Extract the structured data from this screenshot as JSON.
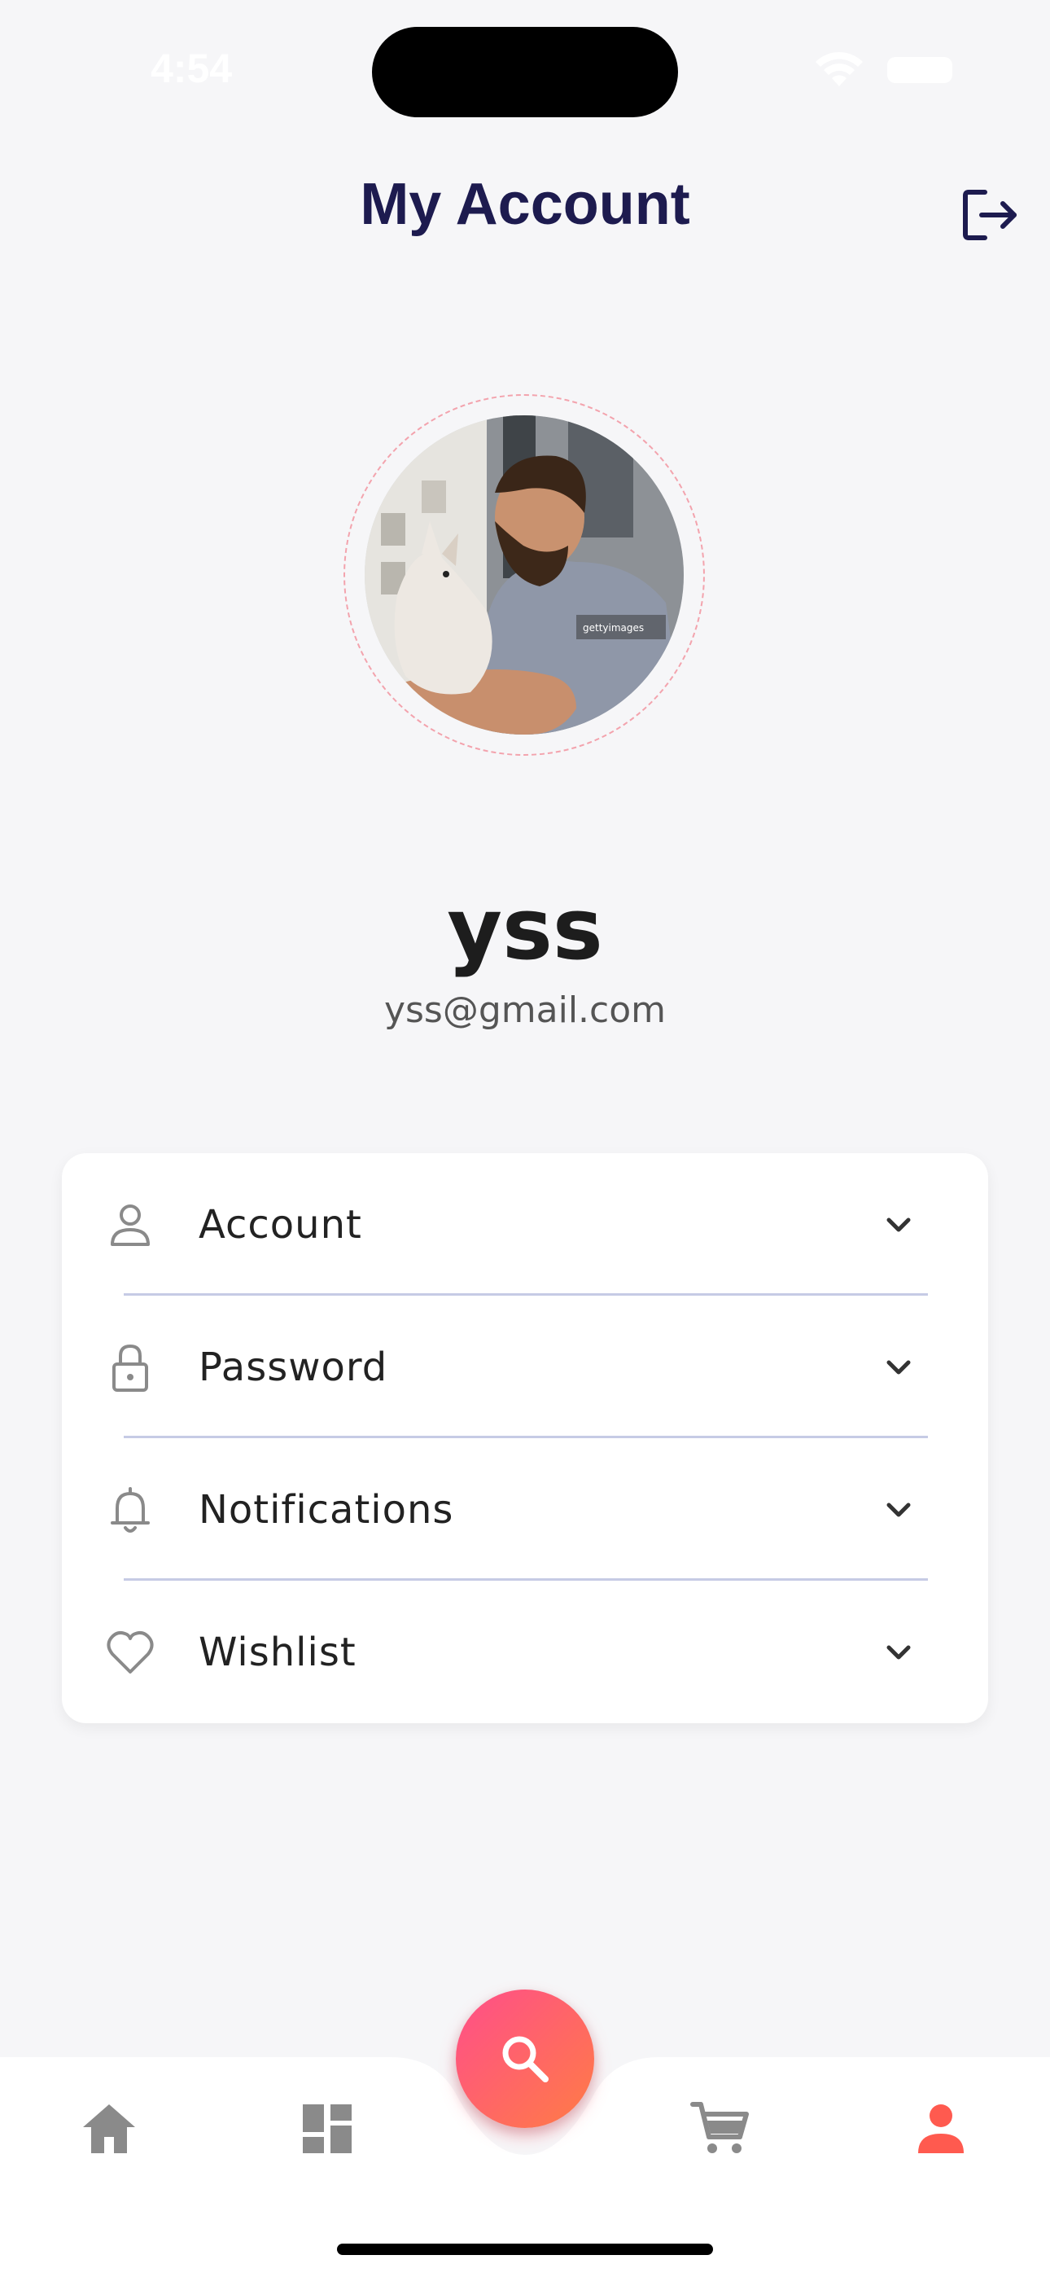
{
  "status_bar": {
    "time": "4:54"
  },
  "header": {
    "title": "My Account",
    "logout_icon": "logout-icon"
  },
  "profile": {
    "name": "yss",
    "email": "yss@gmail.com",
    "avatar_alt": "profile photo"
  },
  "menu": {
    "items": [
      {
        "label": "Account",
        "icon": "person-icon"
      },
      {
        "label": "Password",
        "icon": "lock-icon"
      },
      {
        "label": "Notifications",
        "icon": "bell-icon"
      },
      {
        "label": "Wishlist",
        "icon": "heart-icon"
      }
    ]
  },
  "bottom_nav": {
    "items": [
      {
        "name": "home",
        "icon": "home-icon"
      },
      {
        "name": "categories",
        "icon": "dashboard-icon"
      },
      {
        "name": "search",
        "icon": "search-icon"
      },
      {
        "name": "cart",
        "icon": "cart-icon"
      },
      {
        "name": "profile",
        "icon": "person-icon",
        "active": true
      }
    ]
  },
  "colors": {
    "background": "#f6f6f8",
    "title": "#1d1b4f",
    "accent": "#ff5a5f",
    "fab_gradient_start": "#ff4e8a",
    "fab_gradient_end": "#ff7c45",
    "divider": "#c6cbe5",
    "icon_gray": "#8a8a8a"
  }
}
